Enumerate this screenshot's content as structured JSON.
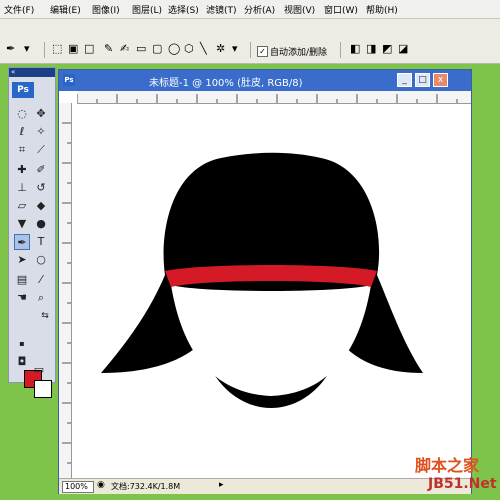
{
  "menu": [
    "文件(F)",
    "编辑(E)",
    "图像(I)",
    "图层(L)",
    "选择(S)",
    "滤镜(T)",
    "分析(A)",
    "视图(V)",
    "窗口(W)",
    "帮助(H)"
  ],
  "options_bar": {
    "auto_add_delete_label": "自动添加/删除",
    "auto_add_delete_checked": true
  },
  "toolbox": {
    "logo": "Ps",
    "header": "«"
  },
  "document": {
    "title": "未标题-1 @ 100% (肚皮, RGB/8)",
    "zoom": "100%",
    "doc_info": "文档:732.4K/1.8M",
    "min_label": "_",
    "max_label": "□",
    "close_label": "x"
  },
  "colors": {
    "foreground": "#d41a27",
    "background": "#ffffff",
    "hat": "#000000",
    "band": "#d41a27"
  },
  "watermark": {
    "line1": "脚本之家",
    "line2": "JB51.Net"
  }
}
